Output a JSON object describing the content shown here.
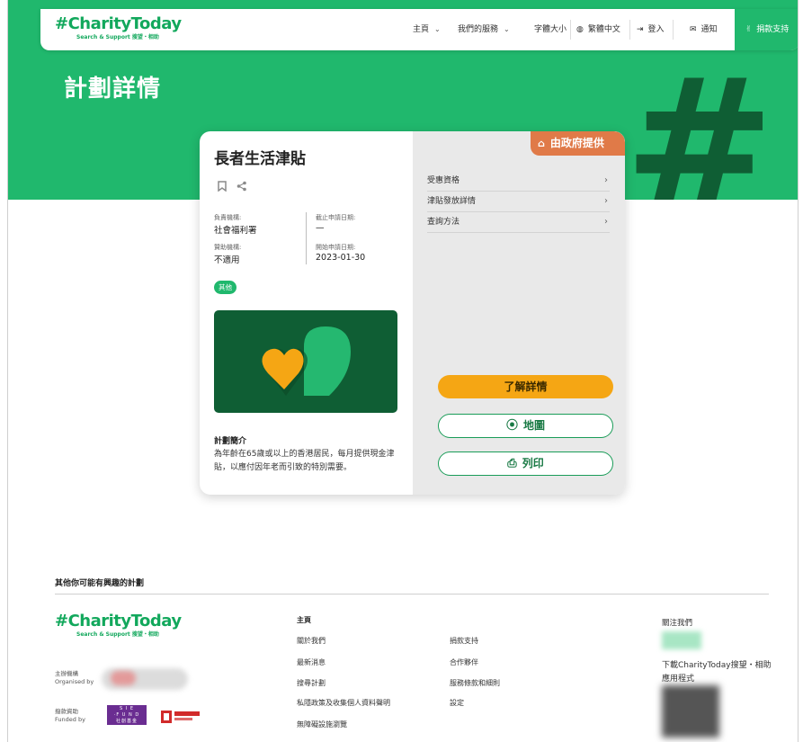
{
  "colors": {
    "brand_green": "#20b86d",
    "dark_green": "#0f5e34",
    "accent_orange": "#f5a614",
    "badge_orange": "#e07a48"
  },
  "nav": {
    "logo": "#CharityToday",
    "logo_sub": "Search & Support 搜望・相助",
    "home": "主頁",
    "services": "我們的服務",
    "font_size": "字體大小",
    "language": "繁體中文",
    "login": "登入",
    "notify": "通知",
    "donate": "捐款支持"
  },
  "hero": {
    "title": "計劃詳情",
    "bg_mark": "#"
  },
  "card": {
    "title": "長者生活津貼",
    "gov_badge": "由政府提供",
    "meta": {
      "org_label": "負責機構:",
      "org_value": "社會福利署",
      "deadline_label": "截止申請日期:",
      "deadline_value": "—",
      "funding_label": "贊助機構:",
      "funding_value": "不適用",
      "start_label": "開始申請日期:",
      "start_value": "2023-01-30"
    },
    "tag": "其他",
    "intro_heading": "計劃簡介",
    "intro_text": "為年齡在65歲或以上的香港居民，每月提供現金津貼，以應付因年老而引致的特別需要。",
    "accordion": [
      "受惠資格",
      "津貼發放詳情",
      "查詢方法"
    ],
    "btn_more": "了解詳情",
    "btn_map": "地圖",
    "btn_print": "列印"
  },
  "recommend": {
    "title": "其他你可能有興趣的計劃"
  },
  "footer": {
    "logo": "#CharityToday",
    "logo_sub": "Search & Support 搜望・相助",
    "organised_cn": "主辦機構",
    "organised_en": "Organised by",
    "funded_cn": "撥款資助",
    "funded_en": "Funded by",
    "sie_text": "S I E\n·F U N D\n社創基金",
    "col_head": "主頁",
    "col1": [
      "關於我們",
      "最新消息",
      "搜尋計劃",
      "私隱政策及收集個人資料聲明",
      "無障礙設施瀏覽"
    ],
    "col2": [
      "捐款支持",
      "合作夥伴",
      "服務條款和細則",
      "設定"
    ],
    "follow": "關注我們",
    "download": "下載CharityToday搜望・相助應用程式"
  }
}
